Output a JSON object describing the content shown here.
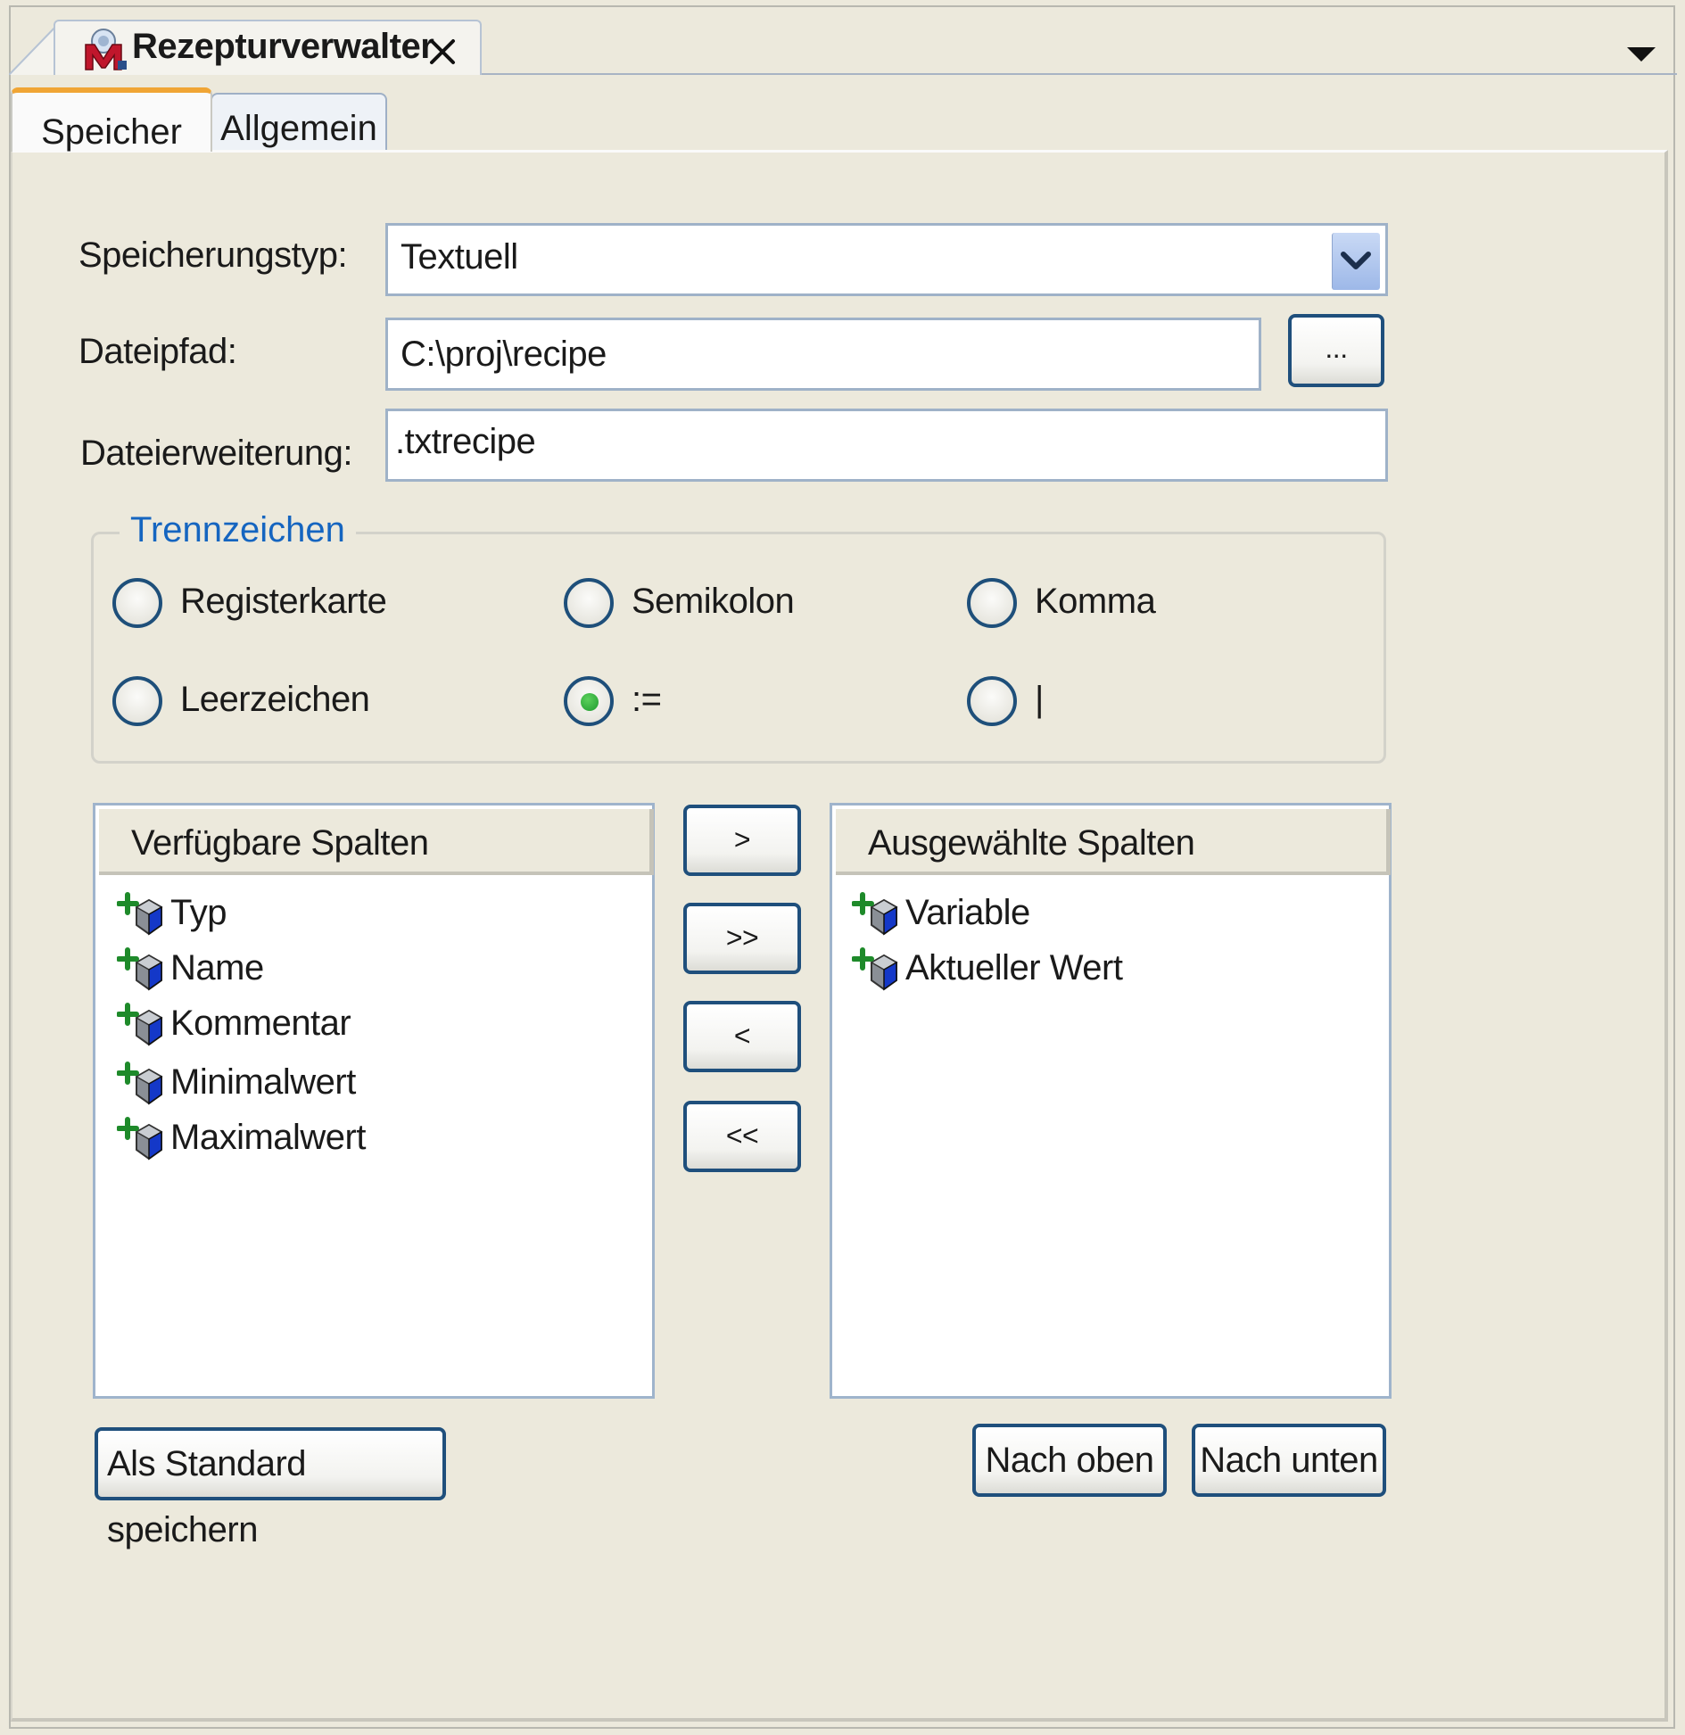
{
  "window": {
    "tab_title": "Rezepturverwalter",
    "tab_icon": "recipe-manager-icon",
    "close_icon": "close-icon",
    "menu_icon": "dropdown-triangle-icon"
  },
  "tabs": [
    {
      "label": "Speicher",
      "active": true
    },
    {
      "label": "Allgemein",
      "active": false
    }
  ],
  "form": {
    "storage_type_label": "Speicherungstyp:",
    "storage_type_value": "Textuell",
    "file_path_label": "Dateipfad:",
    "file_path_value": "C:\\proj\\recipe",
    "browse_label": "...",
    "file_ext_label": "Dateierweiterung:",
    "file_ext_value": ".txtrecipe"
  },
  "separator": {
    "title": "Trennzeichen",
    "options": [
      {
        "label": "Registerkarte",
        "selected": false
      },
      {
        "label": "Semikolon",
        "selected": false
      },
      {
        "label": "Komma",
        "selected": false
      },
      {
        "label": "Leerzeichen",
        "selected": false
      },
      {
        "label": ":=",
        "selected": true
      },
      {
        "label": "|",
        "selected": false
      }
    ]
  },
  "available_columns": {
    "header": "Verfügbare Spalten",
    "items": [
      "Typ",
      "Name",
      "Kommentar",
      "Minimalwert",
      "Maximalwert"
    ]
  },
  "selected_columns": {
    "header": "Ausgewählte Spalten",
    "items": [
      "Variable",
      "Aktueller Wert"
    ]
  },
  "transfer_buttons": {
    "add": ">",
    "add_all": ">>",
    "remove": "<",
    "remove_all": "<<"
  },
  "actions": {
    "save_default": "Als Standard speichern",
    "move_up": "Nach oben",
    "move_down": "Nach unten"
  },
  "colors": {
    "background": "#ece9dc",
    "accent_tab": "#f0a535",
    "button_border": "#1f4f7c",
    "group_title": "#1565c0",
    "radio_selected": "#1f9a2f"
  }
}
